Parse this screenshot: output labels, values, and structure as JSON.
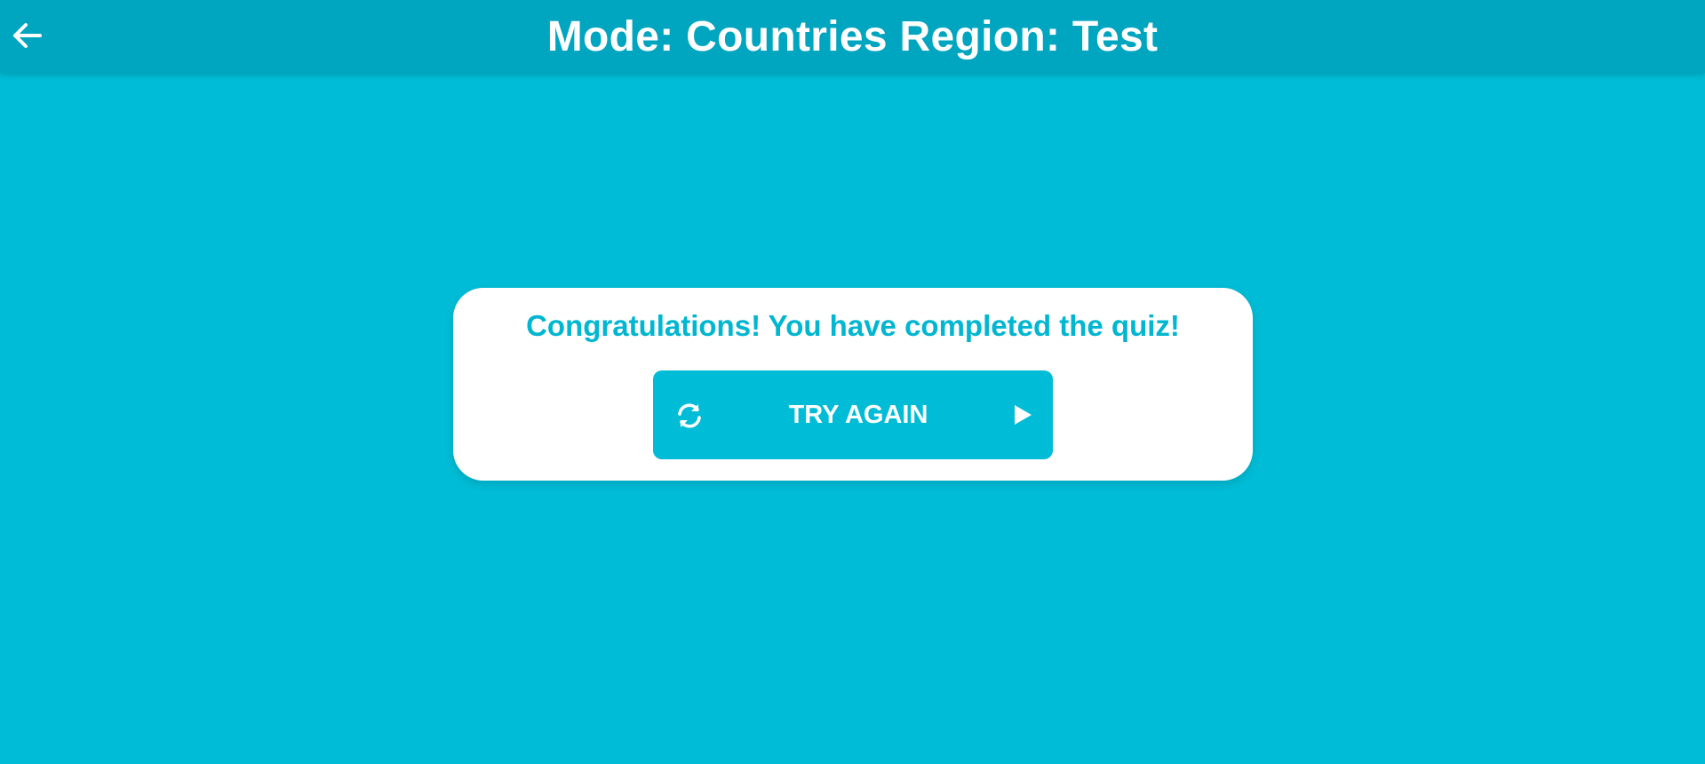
{
  "header": {
    "title": "Mode: Countries Region: Test",
    "back_icon": "arrow-left-icon"
  },
  "result": {
    "message": "Congratulations! You have completed the quiz!",
    "try_again_label": "TRY AGAIN",
    "left_icon": "refresh-icon",
    "right_icon": "play-icon"
  },
  "colors": {
    "background": "#00bcd6",
    "app_bar": "#00a5c0",
    "card": "#ffffff",
    "accent_text": "#00b6d1",
    "button": "#00bcd6",
    "button_text": "#ffffff"
  }
}
